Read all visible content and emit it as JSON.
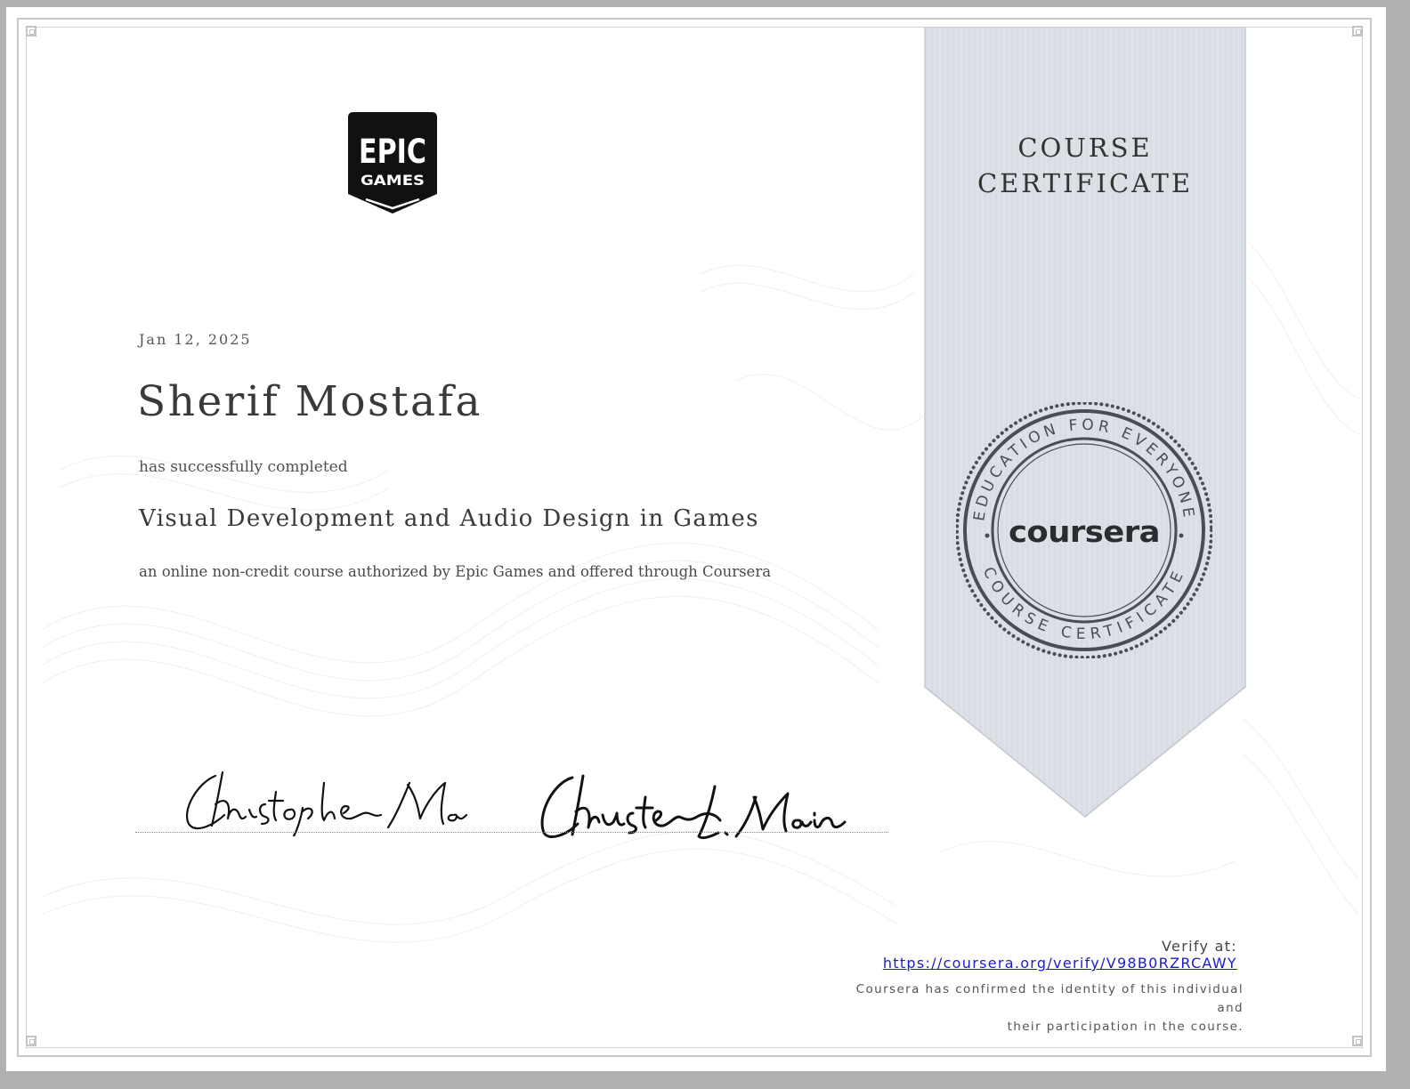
{
  "certificate": {
    "issuer_logo": "epic-games-logo",
    "logo_text_line1": "EPIC",
    "logo_text_line2": "GAMES",
    "date": "Jan 12, 2025",
    "recipient_name": "Sherif Mostafa",
    "completed_text": "has successfully completed",
    "course_title": "Visual Development and Audio Design in Games",
    "description": "an online non-credit course authorized by Epic Games and offered through Coursera"
  },
  "ribbon": {
    "title_line1": "COURSE",
    "title_line2": "CERTIFICATE",
    "color": "#dde1e7"
  },
  "seal": {
    "top_text": "EDUCATION FOR EVERYONE",
    "bottom_text": "COURSE CERTIFICATE",
    "center_text": "coursera",
    "color": "#4a4d52"
  },
  "signatures": [
    {
      "icon": "handwritten-signature"
    },
    {
      "icon": "handwritten-signature"
    }
  ],
  "verification": {
    "label": "Verify at:",
    "url": "https://coursera.org/verify/V98B0RZRCAWY",
    "confirm_line1": "Coursera has confirmed the identity of this individual and",
    "confirm_line2": "their participation in the course."
  }
}
